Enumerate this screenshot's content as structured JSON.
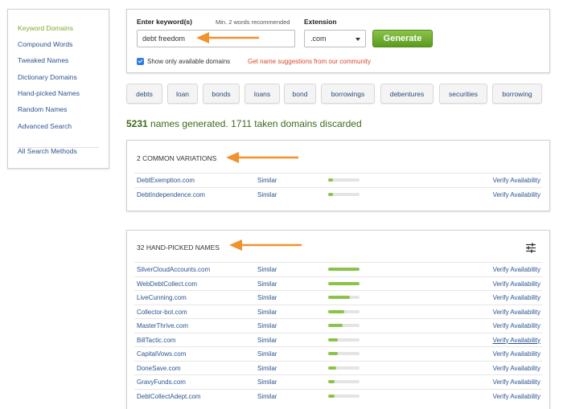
{
  "sidebar": {
    "items": [
      {
        "label": "Keyword Domains",
        "active": true
      },
      {
        "label": "Compound Words",
        "active": false
      },
      {
        "label": "Tweaked Names",
        "active": false
      },
      {
        "label": "Dictionary Domains",
        "active": false
      },
      {
        "label": "Hand-picked Names",
        "active": false
      },
      {
        "label": "Random Names",
        "active": false
      },
      {
        "label": "Advanced Search",
        "active": false
      }
    ],
    "footer_item": "All Search Methods"
  },
  "search": {
    "keyword_label": "Enter keyword(s)",
    "keyword_hint": "Min. 2 words recommended",
    "keyword_value": "debt freedom",
    "extension_label": "Extension",
    "extension_value": ".com",
    "generate_label": "Generate",
    "available_only_label": "Show only available domains",
    "available_only_checked": true,
    "suggestions_link": "Get name suggestions from our community"
  },
  "tags": [
    "debts",
    "loan",
    "bonds",
    "loans",
    "bond",
    "borrowings",
    "debentures",
    "securities",
    "borrowing"
  ],
  "summary": {
    "generated_count": "5231",
    "generated_text": " names generated. 1711 taken domains discarded"
  },
  "common_variations": {
    "title": "2 COMMON VARIATIONS",
    "rows": [
      {
        "domain": "DebtExemption.com",
        "similar": "Similar",
        "strength": 0.15,
        "verify": "Verify Availability"
      },
      {
        "domain": "DebtIndependence.com",
        "similar": "Similar",
        "strength": 0.15,
        "verify": "Verify Availability"
      }
    ]
  },
  "hand_picked": {
    "title": "32 HAND-PICKED NAMES",
    "filter_icon": "sliders-icon",
    "rows": [
      {
        "domain": "SilverCloudAccounts.com",
        "similar": "Similar",
        "strength": 1.0,
        "verify": "Verify Availability"
      },
      {
        "domain": "WebDebtCollect.com",
        "similar": "Similar",
        "strength": 1.0,
        "verify": "Verify Availability"
      },
      {
        "domain": "LiveCunning.com",
        "similar": "Similar",
        "strength": 0.7,
        "verify": "Verify Availability"
      },
      {
        "domain": "Collector-bot.com",
        "similar": "Similar",
        "strength": 0.5,
        "verify": "Verify Availability"
      },
      {
        "domain": "MasterThrive.com",
        "similar": "Similar",
        "strength": 0.45,
        "verify": "Verify Availability"
      },
      {
        "domain": "BillTactic.com",
        "similar": "Similar",
        "strength": 0.3,
        "verify": "Verify Availability"
      },
      {
        "domain": "CapitalVows.com",
        "similar": "Similar",
        "strength": 0.3,
        "verify": "Verify Availability"
      },
      {
        "domain": "DoneSave.com",
        "similar": "Similar",
        "strength": 0.25,
        "verify": "Verify Availability"
      },
      {
        "domain": "GravyFunds.com",
        "similar": "Similar",
        "strength": 0.2,
        "verify": "Verify Availability"
      },
      {
        "domain": "DebtCollectAdept.com",
        "similar": "Similar",
        "strength": 0.2,
        "verify": "Verify Availability"
      }
    ]
  },
  "colors": {
    "accent_green": "#8bc34a",
    "link_blue": "#2a5592",
    "annotation_orange": "#f0922e",
    "suggest_red": "#d9472b"
  }
}
